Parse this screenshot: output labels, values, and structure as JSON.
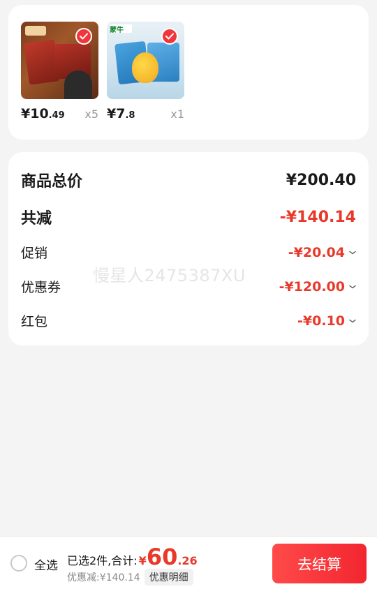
{
  "products": [
    {
      "price_int": "¥10",
      "price_dec": ".49",
      "qty": "x5",
      "checked": true,
      "thumb_icon": "chocolate-ice-cream-pack"
    },
    {
      "price_int": "¥7",
      "price_dec": ".8",
      "qty": "x1",
      "checked": true,
      "brand": "蒙牛",
      "thumb_icon": "mango-ice-cream-pack"
    }
  ],
  "summary": {
    "total_label": "商品总价",
    "total_value": "¥200.40",
    "reduction_label": "共减",
    "reduction_value": "-¥140.14",
    "items": [
      {
        "label": "促销",
        "value": "-¥20.04"
      },
      {
        "label": "优惠券",
        "value": "-¥120.00"
      },
      {
        "label": "红包",
        "value": "-¥0.10"
      }
    ]
  },
  "watermark": "慢星人2475387XU",
  "bottom_bar": {
    "select_all_label": "全选",
    "selected_text": "已选2件,合计:",
    "total_yen": "¥",
    "total_int": "60",
    "total_dec": ".26",
    "discount_text": "优惠减:¥140.14",
    "detail_label": "优惠明细",
    "checkout_label": "去结算"
  },
  "colors": {
    "accent": "#e8392a",
    "checkout_bg": "#f2262f",
    "page_bg": "#f4f4f4"
  }
}
